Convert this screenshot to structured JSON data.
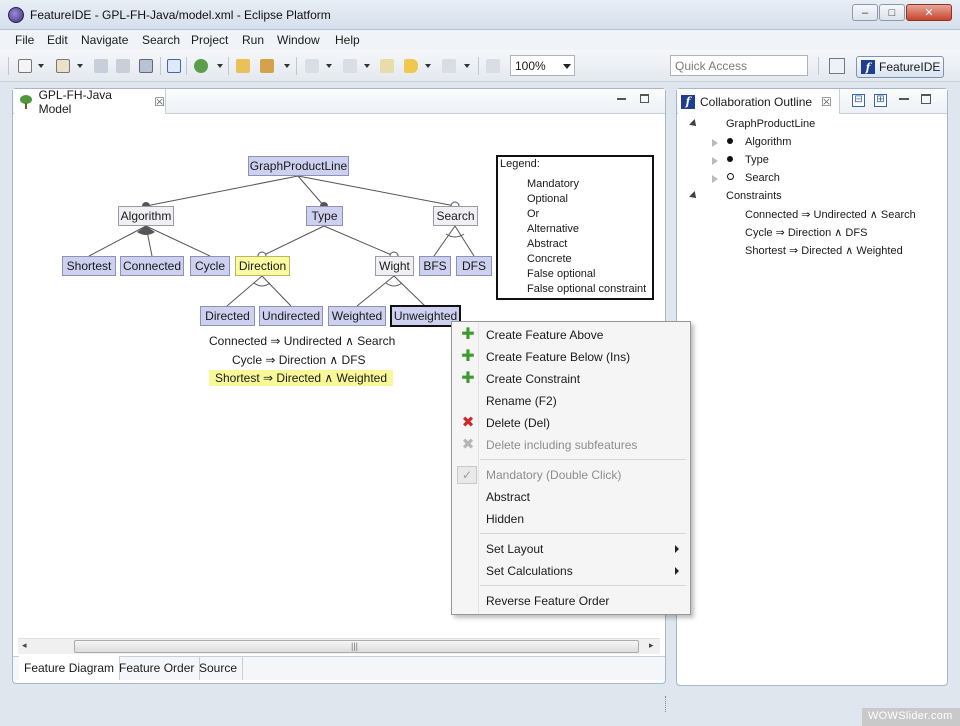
{
  "window": {
    "title": "FeatureIDE - GPL-FH-Java/model.xml - Eclipse Platform",
    "controls": {
      "minimize": "–",
      "maximize": "□",
      "close": "✕"
    }
  },
  "menubar": [
    "File",
    "Edit",
    "Navigate",
    "Search",
    "Project",
    "Run",
    "Window",
    "Help"
  ],
  "toolbar": {
    "zoom_value": "100%",
    "quick_access_placeholder": "Quick Access",
    "perspective_label": "FeatureIDE",
    "perspective_logo": "f"
  },
  "editor": {
    "tab_title": "GPL-FH-Java Model",
    "tab_close": "☒",
    "features": {
      "root": "GraphProductLine",
      "algorithm": "Algorithm",
      "type": "Type",
      "search": "Search",
      "shortest": "Shortest",
      "connected": "Connected",
      "cycle": "Cycle",
      "direction": "Direction",
      "wight": "Wight",
      "bfs": "BFS",
      "dfs": "DFS",
      "directed": "Directed",
      "undirected": "Undirected",
      "weighted": "Weighted",
      "unweighted": "Unweighted"
    },
    "constraints": [
      "Connected  ⇒  Undirected  ∧  Search",
      "Cycle  ⇒  Direction  ∧  DFS",
      "Shortest  ⇒  Directed  ∧  Weighted"
    ],
    "legend": {
      "title": "Legend:",
      "items": [
        "Mandatory",
        "Optional",
        "Or",
        "Alternative",
        "Abstract",
        "Concrete",
        "False optional",
        "False optional constraint"
      ]
    },
    "scrollbar": {
      "left": "◂",
      "right": "▸",
      "grip": "|||"
    },
    "bottom_tabs": [
      "Feature Diagram",
      "Feature Order",
      "Source"
    ]
  },
  "context_menu": {
    "items": [
      {
        "label": "Create Feature Above",
        "icon": "plus-icon",
        "enabled": true
      },
      {
        "label": "Create Feature Below (Ins)",
        "icon": "plus-icon",
        "enabled": true
      },
      {
        "label": "Create Constraint",
        "icon": "plus-icon",
        "enabled": true
      },
      {
        "label": "Rename (F2)",
        "icon": "",
        "enabled": true
      },
      {
        "label": "Delete (Del)",
        "icon": "delete-icon",
        "enabled": true
      },
      {
        "label": "Delete including subfeatures",
        "icon": "delete-icon",
        "enabled": false
      },
      {
        "label": "Mandatory (Double Click)",
        "icon": "check-icon",
        "enabled": false
      },
      {
        "label": "Abstract",
        "icon": "",
        "enabled": true
      },
      {
        "label": "Hidden",
        "icon": "",
        "enabled": true
      },
      {
        "label": "Set Layout",
        "icon": "",
        "enabled": true,
        "submenu": true
      },
      {
        "label": "Set Calculations",
        "icon": "",
        "enabled": true,
        "submenu": true
      },
      {
        "label": "Reverse Feature Order",
        "icon": "",
        "enabled": true
      }
    ],
    "glyphs": {
      "plus": "✚",
      "delete": "✖",
      "check": "✓"
    }
  },
  "outline": {
    "tab_title": "Collaboration Outline",
    "tab_close": "☒",
    "logo": "f",
    "collapse_all": "⊟",
    "expand_all": "⊞",
    "tree": {
      "root": "GraphProductLine",
      "children": [
        "Algorithm",
        "Type",
        "Search"
      ],
      "constraints_label": "Constraints",
      "constraints": [
        "Connected  ⇒  Undirected  ∧  Search",
        "Cycle  ⇒  Direction  ∧  DFS",
        "Shortest  ⇒  Directed  ∧  Weighted"
      ]
    }
  },
  "watermark": "WOWSlider.com",
  "colors": {
    "concrete": "#cdd0ee",
    "abstract": "#f0f0f4",
    "false_optional": "#fafaa0",
    "plus": "#3c9b2c",
    "delete": "#cc2a2a"
  }
}
